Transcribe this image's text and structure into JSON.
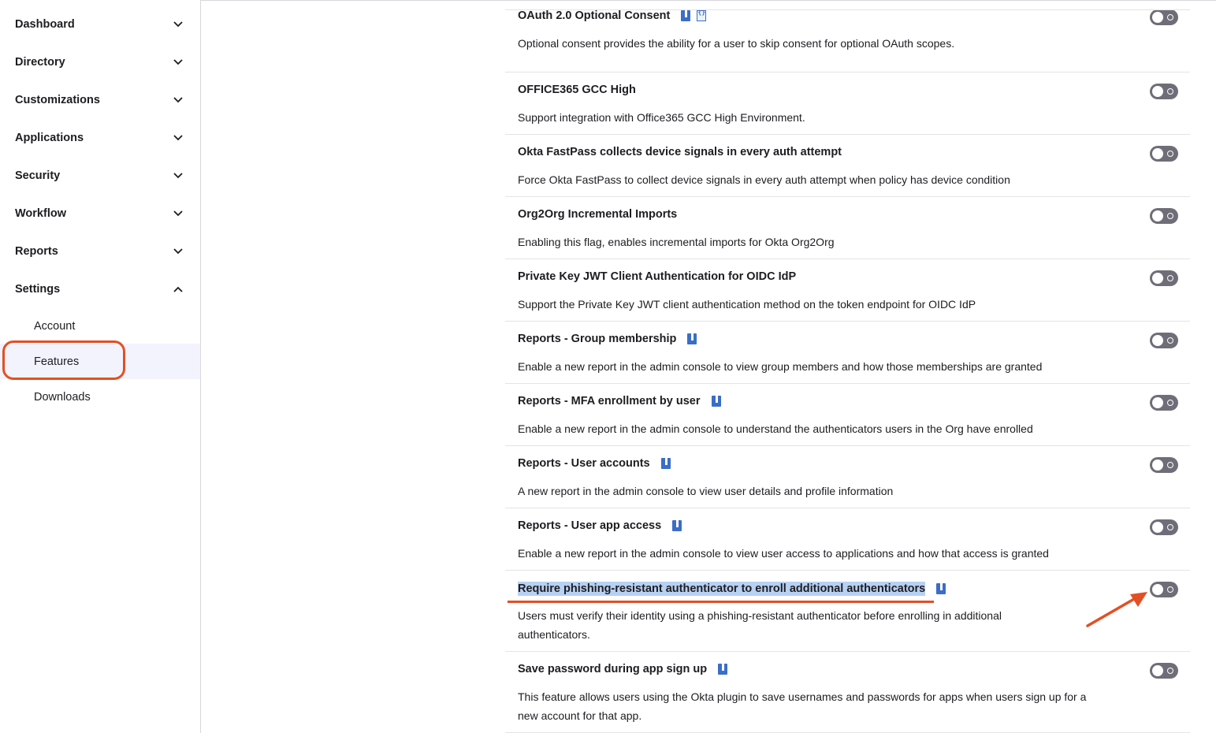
{
  "sidebar": {
    "items": [
      {
        "label": "Dashboard",
        "expanded": false
      },
      {
        "label": "Directory",
        "expanded": false
      },
      {
        "label": "Customizations",
        "expanded": false
      },
      {
        "label": "Applications",
        "expanded": false
      },
      {
        "label": "Security",
        "expanded": false
      },
      {
        "label": "Workflow",
        "expanded": false
      },
      {
        "label": "Reports",
        "expanded": false
      },
      {
        "label": "Settings",
        "expanded": true
      }
    ],
    "settings_sub_items": [
      {
        "label": "Account"
      },
      {
        "label": "Features",
        "active": true
      },
      {
        "label": "Downloads"
      }
    ]
  },
  "features": [
    {
      "title": "OAuth 2.0 Optional Consent",
      "description": "Optional consent provides the ability for a user to skip consent for optional OAuth scopes.",
      "enabled": false,
      "badges": [
        "doc-icon",
        "code-icon"
      ]
    },
    {
      "title": "OFFICE365 GCC High",
      "description": "Support integration with Office365 GCC High Environment.",
      "enabled": false,
      "badges": []
    },
    {
      "title": "Okta FastPass collects device signals in every auth attempt",
      "description": "Force Okta FastPass to collect device signals in every auth attempt when policy has device condition",
      "enabled": false,
      "badges": []
    },
    {
      "title": "Org2Org Incremental Imports",
      "description": "Enabling this flag, enables incremental imports for Okta Org2Org",
      "enabled": false,
      "badges": []
    },
    {
      "title": "Private Key JWT Client Authentication for OIDC IdP",
      "description": "Support the Private Key JWT client authentication method on the token endpoint for OIDC IdP",
      "enabled": false,
      "badges": []
    },
    {
      "title": "Reports - Group membership",
      "description": "Enable a new report in the admin console to view group members and how those memberships are granted",
      "enabled": false,
      "badges": [
        "doc-icon"
      ]
    },
    {
      "title": "Reports - MFA enrollment by user",
      "description": "Enable a new report in the admin console to understand the authenticators users in the Org have enrolled",
      "enabled": false,
      "badges": [
        "doc-icon"
      ]
    },
    {
      "title": "Reports - User accounts",
      "description": "A new report in the admin console to view user details and profile information",
      "enabled": false,
      "badges": [
        "doc-icon"
      ]
    },
    {
      "title": "Reports - User app access",
      "description": "Enable a new report in the admin console to view user access to applications and how that access is granted",
      "enabled": false,
      "badges": [
        "doc-icon"
      ]
    },
    {
      "title": "Require phishing-resistant authenticator to enroll additional authenticators",
      "description": "Users must verify their identity using a phishing-resistant authenticator before enrolling in additional authenticators.",
      "enabled": false,
      "badges": [
        "doc-icon"
      ],
      "highlighted": true
    },
    {
      "title": "Save password during app sign up",
      "description": "This feature allows users using the Okta plugin to save usernames and passwords for apps when users sign up for a new account for that app.",
      "enabled": false,
      "badges": [
        "doc-icon"
      ]
    }
  ],
  "colors": {
    "annotation": "#e34f24",
    "toggle_off": "#6e6e78",
    "badge": "#3a6ec7",
    "highlight": "#b7d1f3"
  }
}
